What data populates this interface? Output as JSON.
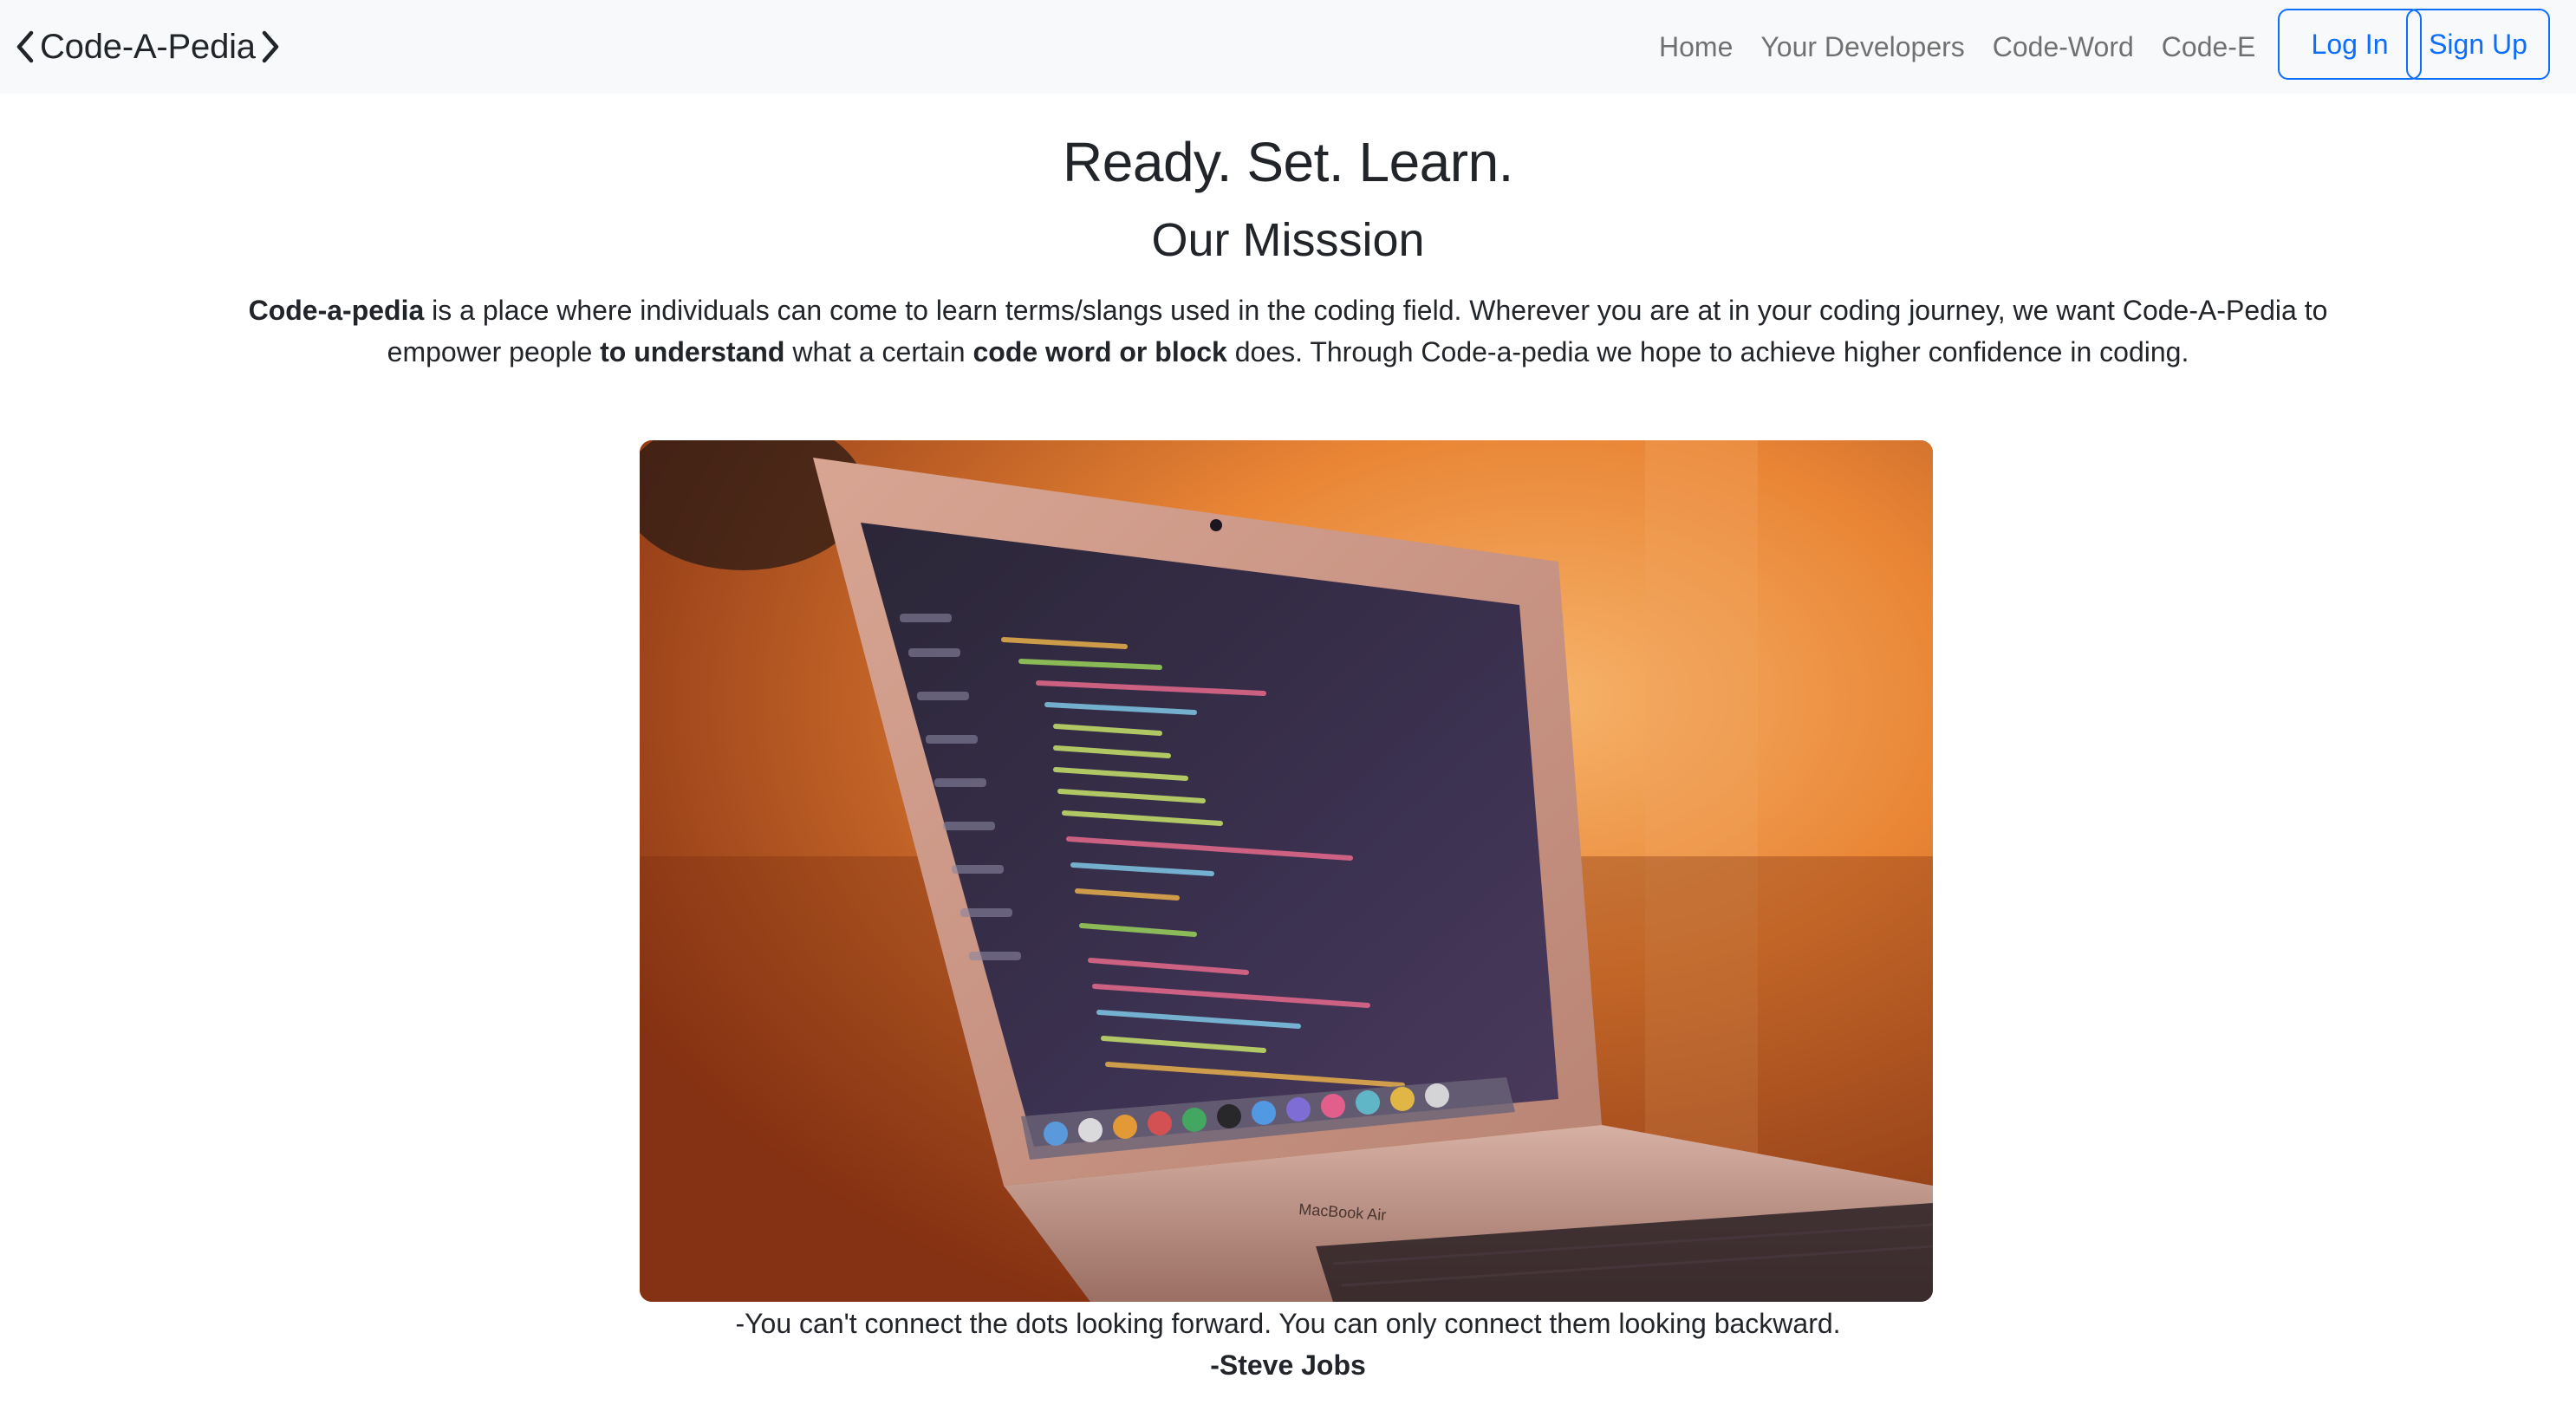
{
  "navbar": {
    "brand_label": "Code-A-Pedia",
    "brand_left_icon": "chevron-left-icon",
    "brand_right_icon": "chevron-right-icon",
    "links": [
      {
        "label": "Home"
      },
      {
        "label": "Your Developers"
      },
      {
        "label": "Code-Word"
      },
      {
        "label": "Code-E"
      }
    ],
    "login_label": "Log In",
    "signup_label": "Sign Up"
  },
  "main": {
    "hero_title": "Ready. Set. Learn.",
    "mission_title": "Our Misssion",
    "mission_parts": [
      {
        "text": "Code-a-pedia",
        "bold": true
      },
      {
        "text": " is a place where individuals can come to learn terms/slangs used in the coding field. Wherever you are at in your coding journey, we want Code-A-Pedia to empower people ",
        "bold": false
      },
      {
        "text": "to understand",
        "bold": true
      },
      {
        "text": " what a certain ",
        "bold": false
      },
      {
        "text": "code word or block",
        "bold": true
      },
      {
        "text": " does. Through Code-a-pedia we hope to achieve higher confidence in coding.",
        "bold": false
      }
    ],
    "image": {
      "subject": "laptop-with-code-photo",
      "laptop_label": "MacBook Air"
    },
    "quote": "-You can't connect the dots looking forward. You can only connect them looking backward.",
    "quote_author": "-Steve Jobs"
  },
  "colors": {
    "navbar_bg": "#f8f9fa",
    "primary": "#0d6efd",
    "text": "#212529",
    "nav_link": "rgba(0,0,0,0.55)"
  }
}
